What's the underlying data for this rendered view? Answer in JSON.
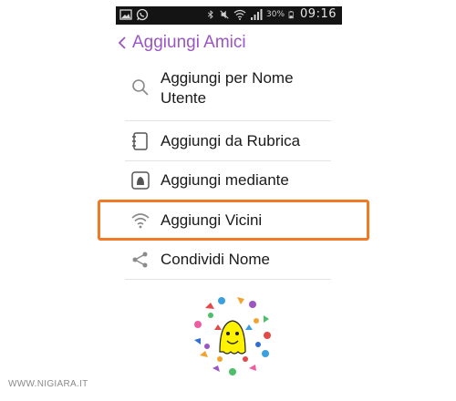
{
  "status_bar": {
    "time": "09:16",
    "battery_percent": "30%",
    "icons": [
      "image-icon",
      "whatsapp-icon",
      "bluetooth-icon",
      "mute-icon",
      "wifi-icon",
      "signal-icon",
      "battery-icon"
    ]
  },
  "header": {
    "title": "Aggiungi Amici",
    "back_icon": "chevron-left-icon",
    "accent_color": "#9a56c4"
  },
  "menu": {
    "items": [
      {
        "label": "Aggiungi per Nome Utente",
        "icon": "search-icon"
      },
      {
        "label": "Aggiungi da Rubrica",
        "icon": "address-book-icon"
      },
      {
        "label": "Aggiungi mediante",
        "icon": "snapcode-icon"
      },
      {
        "label": "Aggiungi Vicini",
        "icon": "wifi-icon"
      },
      {
        "label": "Condividi Nome",
        "icon": "share-icon"
      }
    ]
  },
  "highlight": {
    "target": "Aggiungi Vicini",
    "color": "#f07a25"
  },
  "watermark": {
    "text": "WWW.NIGIARA.IT"
  }
}
